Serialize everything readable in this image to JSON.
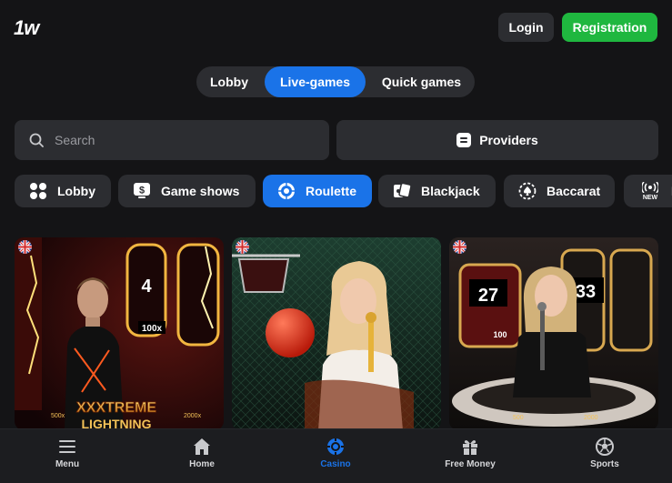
{
  "header": {
    "logo": "1w",
    "login_label": "Login",
    "registration_label": "Registration"
  },
  "tabs": [
    {
      "label": "Lobby"
    },
    {
      "label": "Live-games",
      "active": true
    },
    {
      "label": "Quick games"
    }
  ],
  "search": {
    "placeholder": "Search"
  },
  "providers_label": "Providers",
  "categories": [
    {
      "label": "Lobby",
      "icon": "grid-icon"
    },
    {
      "label": "Game shows",
      "icon": "dollar-tv-icon"
    },
    {
      "label": "Roulette",
      "icon": "roulette-wheel-icon",
      "active": true
    },
    {
      "label": "Blackjack",
      "icon": "cards-icon"
    },
    {
      "label": "Baccarat",
      "icon": "spade-chip-icon"
    },
    {
      "label": "N",
      "icon": "broadcast-icon",
      "badge": "NEW"
    }
  ],
  "games": [
    {
      "banner_text": "XXXTREME",
      "banner_sub_text": "LIGHTNING",
      "tile_number": "4",
      "multiplier": "100x",
      "left_corner": "500x",
      "right_corner": "2000x"
    },
    {
      "banner_text": "",
      "banner_sub_text": ""
    },
    {
      "numbers": [
        "27",
        "33"
      ],
      "multiplier": "100",
      "corner_left": "500",
      "corner_right": "2000"
    }
  ],
  "bottom_nav": [
    {
      "label": "Menu",
      "icon": "hamburger-icon"
    },
    {
      "label": "Home",
      "icon": "home-icon"
    },
    {
      "label": "Casino",
      "icon": "casino-chip-icon",
      "active": true
    },
    {
      "label": "Free Money",
      "icon": "gift-icon"
    },
    {
      "label": "Sports",
      "icon": "soccer-ball-icon"
    }
  ],
  "colors": {
    "accent": "#1a73e8",
    "registration": "#1fb73f",
    "surface": "#2c2d31",
    "background": "#141416"
  }
}
